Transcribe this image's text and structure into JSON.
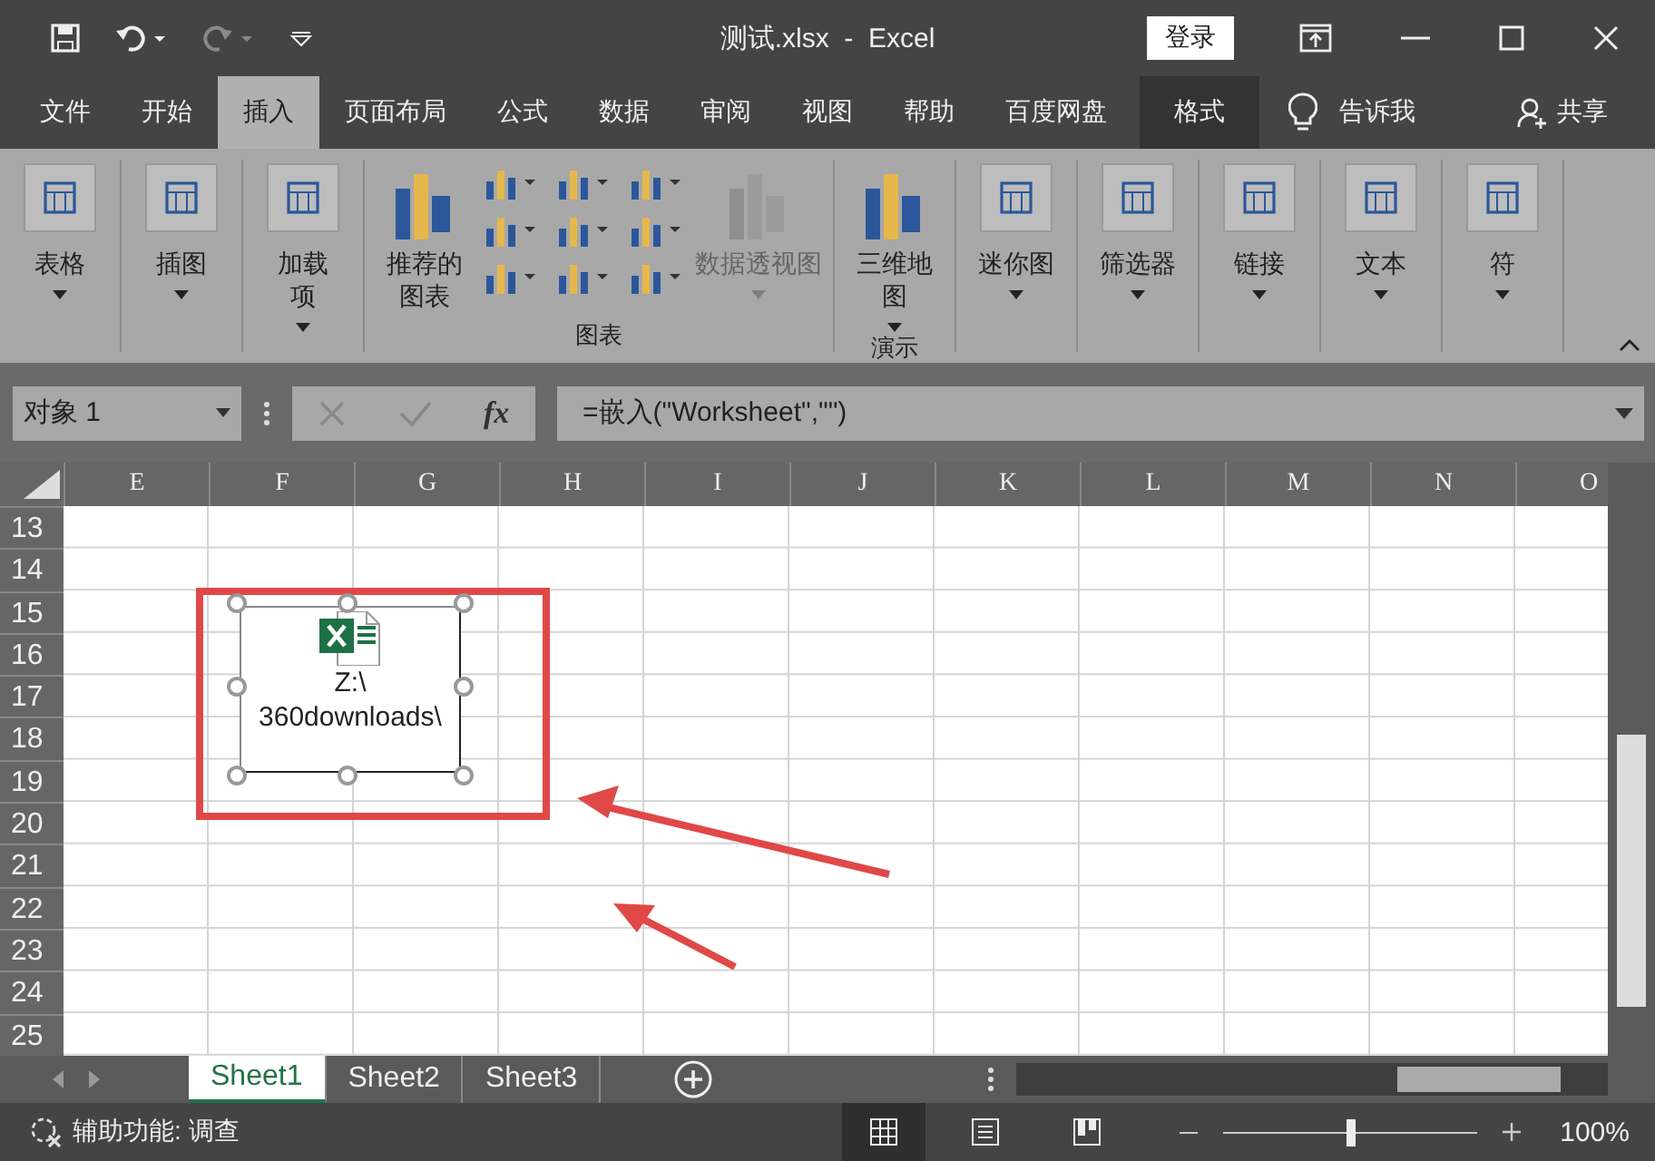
{
  "window": {
    "title": "测试.xlsx  -  Excel",
    "signin": "登录"
  },
  "tabs": [
    {
      "label": "文件",
      "selected": false,
      "kind": "normal"
    },
    {
      "label": "开始",
      "selected": false,
      "kind": "normal"
    },
    {
      "label": "插入",
      "selected": true,
      "kind": "normal"
    },
    {
      "label": "页面布局",
      "selected": false,
      "kind": "normal"
    },
    {
      "label": "公式",
      "selected": false,
      "kind": "normal"
    },
    {
      "label": "数据",
      "selected": false,
      "kind": "normal"
    },
    {
      "label": "审阅",
      "selected": false,
      "kind": "normal"
    },
    {
      "label": "视图",
      "selected": false,
      "kind": "normal"
    },
    {
      "label": "帮助",
      "selected": false,
      "kind": "normal"
    },
    {
      "label": "百度网盘",
      "selected": false,
      "kind": "normal"
    },
    {
      "label": "格式",
      "selected": false,
      "kind": "contextual"
    }
  ],
  "tell_me": "告诉我",
  "share": "共享",
  "ribbon": [
    {
      "items": [
        {
          "kind": "large",
          "lines": [
            "表格"
          ],
          "dropdown": true,
          "disabled": false
        }
      ]
    },
    {
      "items": [
        {
          "kind": "large",
          "lines": [
            "插图"
          ],
          "dropdown": true,
          "disabled": false
        }
      ]
    },
    {
      "items": [
        {
          "kind": "large",
          "lines": [
            "加载",
            "项"
          ],
          "dropdown": true,
          "disabled": false
        }
      ]
    },
    {
      "label": "图表",
      "items": [
        {
          "kind": "chart",
          "lines": [
            "推荐的",
            "图表"
          ],
          "dropdown": false,
          "disabled": false
        },
        {
          "kind": "gallery",
          "dropdown": true,
          "disabled": false
        },
        {
          "kind": "chart",
          "lines": [
            "数据透视图"
          ],
          "dropdown": true,
          "disabled": true
        }
      ]
    },
    {
      "label": "演示",
      "items": [
        {
          "kind": "chart",
          "lines": [
            "三维地",
            "图"
          ],
          "dropdown": true,
          "disabled": false
        }
      ]
    },
    {
      "items": [
        {
          "kind": "large",
          "lines": [
            "迷你图"
          ],
          "dropdown": true,
          "disabled": false
        }
      ]
    },
    {
      "items": [
        {
          "kind": "large",
          "lines": [
            "筛选器"
          ],
          "dropdown": true,
          "disabled": false
        }
      ]
    },
    {
      "items": [
        {
          "kind": "large",
          "lines": [
            "链接"
          ],
          "dropdown": true,
          "disabled": false
        }
      ]
    },
    {
      "items": [
        {
          "kind": "large",
          "lines": [
            "文本"
          ],
          "dropdown": true,
          "disabled": false
        }
      ]
    },
    {
      "items": [
        {
          "kind": "large",
          "lines": [
            "符"
          ],
          "dropdown": true,
          "disabled": false
        }
      ]
    }
  ],
  "formula_bar": {
    "name_box": "对象 1",
    "fx": "fx",
    "formula": "=嵌入(\"Worksheet\",\"\")"
  },
  "columns": [
    "E",
    "F",
    "G",
    "H",
    "I",
    "J",
    "K",
    "L",
    "M",
    "N",
    "O"
  ],
  "rows": [
    "13",
    "14",
    "15",
    "16",
    "17",
    "18",
    "19",
    "20",
    "21",
    "22",
    "23",
    "24",
    "25"
  ],
  "embedded_object": {
    "lines": [
      "Z:\\",
      "360downloads\\"
    ]
  },
  "sheets": [
    {
      "label": "Sheet1",
      "selected": true
    },
    {
      "label": "Sheet2",
      "selected": false
    },
    {
      "label": "Sheet3",
      "selected": false
    }
  ],
  "status_bar": {
    "accessibility": "辅助功能: 调查",
    "views": [
      {
        "kind": "normal",
        "selected": true
      },
      {
        "kind": "layout",
        "selected": false
      },
      {
        "kind": "break",
        "selected": false
      }
    ],
    "zoom": {
      "level": 0.5,
      "reading": "100%"
    }
  }
}
